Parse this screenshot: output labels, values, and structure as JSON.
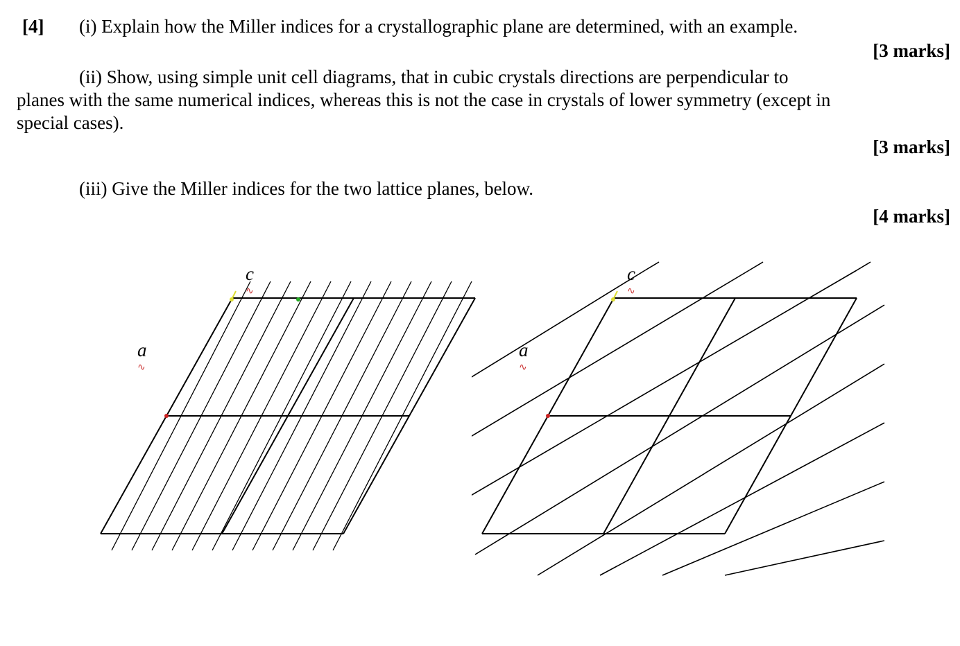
{
  "question": {
    "number_label": "[4]",
    "part_i": "(i) Explain how the Miller indices for a crystallographic plane are determined, with an example.",
    "marks_i": "[3 marks]",
    "part_ii_line1": "(ii) Show, using simple unit cell diagrams, that in cubic crystals directions are perpendicular to",
    "part_ii_line2": "planes with the same numerical indices, whereas this is not the case in crystals of lower symmetry (except in",
    "part_ii_line3": "special cases).",
    "marks_ii": "[3 marks]",
    "part_iii": "(iii) Give the Miller indices for the two lattice planes, below.",
    "marks_iii": "[4 marks]"
  },
  "labels": {
    "axis_a": "a",
    "axis_c": "c"
  }
}
